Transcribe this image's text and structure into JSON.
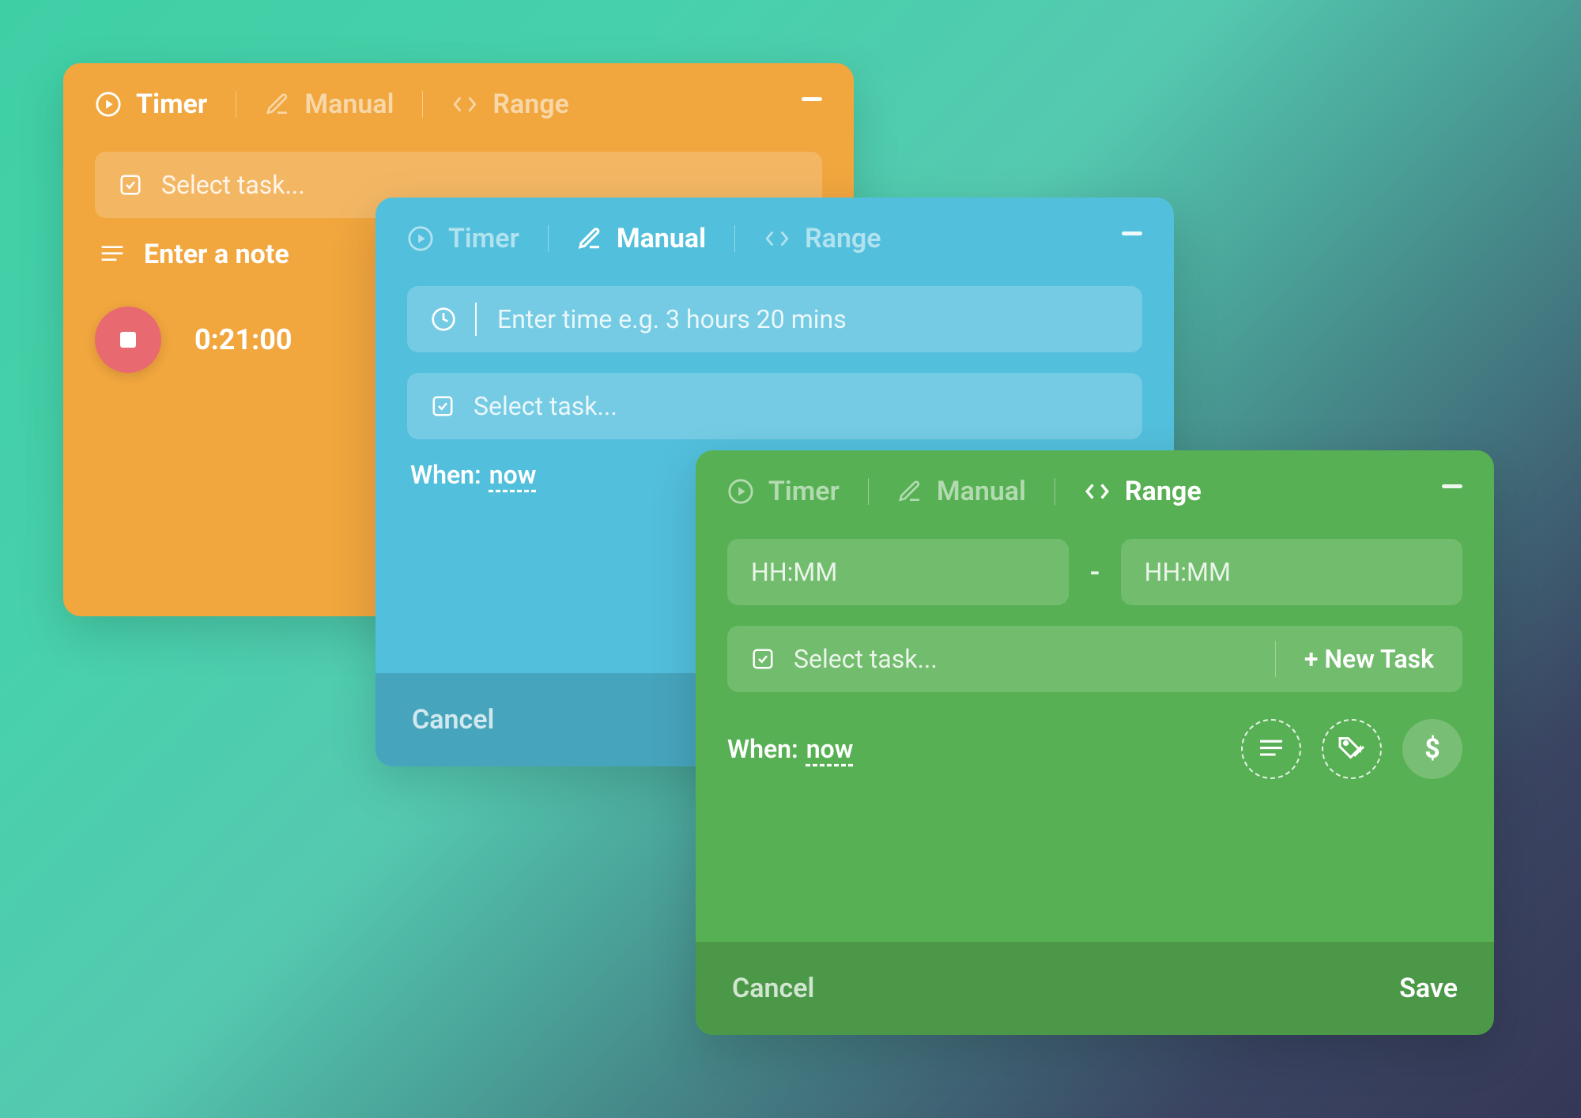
{
  "tabs": {
    "timer": "Timer",
    "manual": "Manual",
    "range": "Range"
  },
  "orange": {
    "select_task": "Select task...",
    "enter_note": "Enter a note",
    "time": "0:21:00"
  },
  "blue": {
    "time_placeholder": "Enter time e.g. 3 hours 20 mins",
    "select_task": "Select task...",
    "when_label": "When:",
    "when_value": "now",
    "cancel": "Cancel"
  },
  "green": {
    "hhmm": "HH:MM",
    "select_task": "Select task...",
    "new_task": "+ New Task",
    "when_label": "When:",
    "when_value": "now",
    "dollar": "$",
    "cancel": "Cancel",
    "save": "Save"
  }
}
